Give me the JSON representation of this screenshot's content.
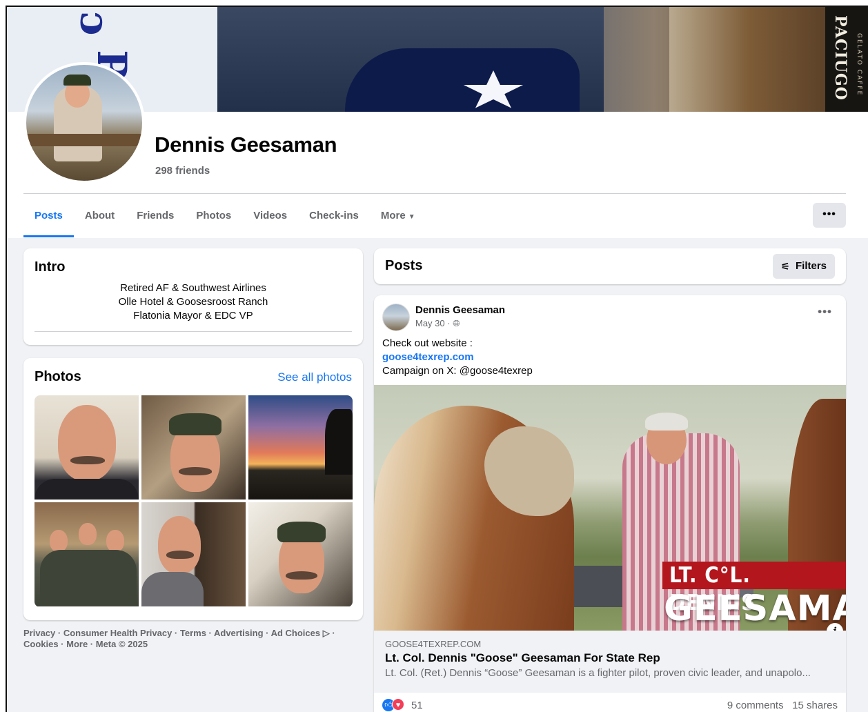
{
  "profile": {
    "name": "Dennis Geesaman",
    "friends": "298 friends"
  },
  "cover": {
    "shop_sign": "PACIUGO",
    "shop_sub": "GELATO CAFFE"
  },
  "tabs": [
    {
      "label": "Posts",
      "active": true
    },
    {
      "label": "About"
    },
    {
      "label": "Friends"
    },
    {
      "label": "Photos"
    },
    {
      "label": "Videos"
    },
    {
      "label": "Check-ins"
    },
    {
      "label": "More"
    }
  ],
  "more_button": "•••",
  "intro": {
    "title": "Intro",
    "bio": [
      "Retired AF & Southwest Airlines",
      "Olle Hotel & Goosesroost Ranch",
      "Flatonia Mayor & EDC VP"
    ]
  },
  "photos": {
    "title": "Photos",
    "see_all": "See all photos"
  },
  "footer": {
    "line1": "Privacy · Consumer Health Privacy · Terms · Advertising · Ad Choices ▷ ·",
    "line2": "Cookies · More · Meta © 2025"
  },
  "posts": {
    "title": "Posts",
    "filters": "Filters"
  },
  "post": {
    "author": "Dennis Geesaman",
    "date": "May 30 · ",
    "dots": "•••",
    "text_line1": "Check out website :",
    "link": "goose4texrep.com",
    "text_line3": "Campaign on X: @goose4texrep",
    "image_banner1": "LT. C°L. DENNIS",
    "image_banner2": "GEESAMAN",
    "link_domain": "GOOSE4TEXREP.COM",
    "link_title": "Lt. Col. Dennis \"Goose\" Geesaman For State Rep",
    "link_desc": "Lt. Col. (Ret.) Dennis “Goose” Geesaman is a fighter pilot, proven civic leader, and unapolo...",
    "reaction_count": "51",
    "comments": "9 comments",
    "shares": "15 shares"
  },
  "colors": {
    "accent": "#1877f2",
    "secondary_text": "#65676b",
    "page_bg": "#f0f2f5"
  }
}
